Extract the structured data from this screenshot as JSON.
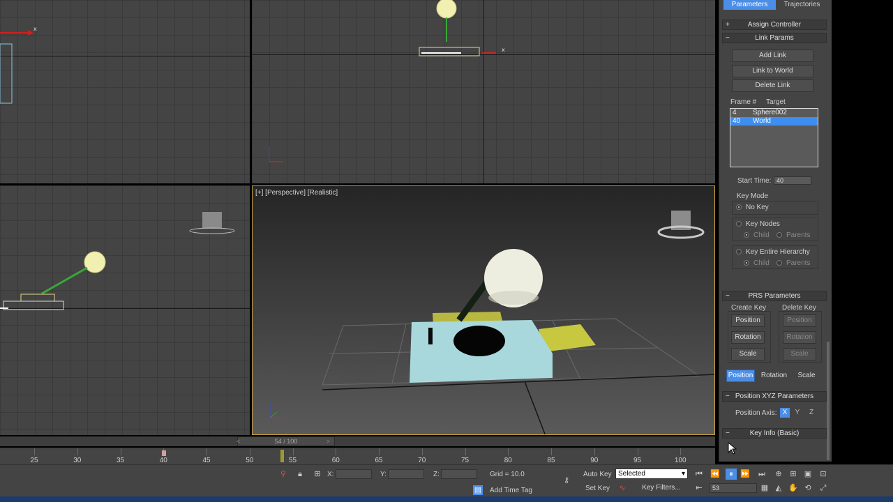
{
  "viewports": {
    "perspective_label": "[+] [Perspective] [Realistic]"
  },
  "panel": {
    "tabs": [
      "Parameters",
      "Trajectories"
    ],
    "assign_controller": {
      "pm": "+",
      "title": "Assign Controller"
    },
    "link_params": {
      "pm": "−",
      "title": "Link Params"
    },
    "add_link": "Add Link",
    "link_to_world": "Link to World",
    "delete_link": "Delete Link",
    "list_header": {
      "frame": "Frame #",
      "target": "Target"
    },
    "list_rows": [
      {
        "frame": "4",
        "target": "Sphere002",
        "selected": false
      },
      {
        "frame": "40",
        "target": "World",
        "selected": true
      }
    ],
    "start_time_label": "Start Time:",
    "start_time_value": "40",
    "key_mode_label": "Key Mode",
    "no_key": "No Key",
    "key_nodes": "Key Nodes",
    "key_entire": "Key Entire Hierarchy",
    "child": "Child",
    "parents": "Parents",
    "prs": {
      "pm": "−",
      "title": "PRS Parameters"
    },
    "create_key": "Create Key",
    "delete_key": "Delete Key",
    "position": "Position",
    "rotation": "Rotation",
    "scale": "Scale",
    "pos_xyz": {
      "pm": "−",
      "title": "Position XYZ Parameters"
    },
    "position_axis_label": "Position Axis:",
    "axis_x": "X",
    "axis_y": "Y",
    "axis_z": "Z",
    "key_info": {
      "pm": "−",
      "title": "Key Info (Basic)"
    }
  },
  "timeline": {
    "thumb": "54 / 100",
    "prev": "<",
    "next": ">",
    "ticks": [
      "25",
      "30",
      "35",
      "40",
      "45",
      "50",
      "55",
      "60",
      "65",
      "70",
      "75",
      "80",
      "85",
      "90",
      "95",
      "100"
    ]
  },
  "status": {
    "x_label": "X:",
    "y_label": "Y:",
    "z_label": "Z:",
    "grid": "Grid = 10.0",
    "add_time_tag": "Add Time Tag",
    "auto_key": "Auto Key",
    "selected": "Selected",
    "set_key": "Set Key",
    "key_filters": "Key Filters...",
    "frame": "53"
  }
}
